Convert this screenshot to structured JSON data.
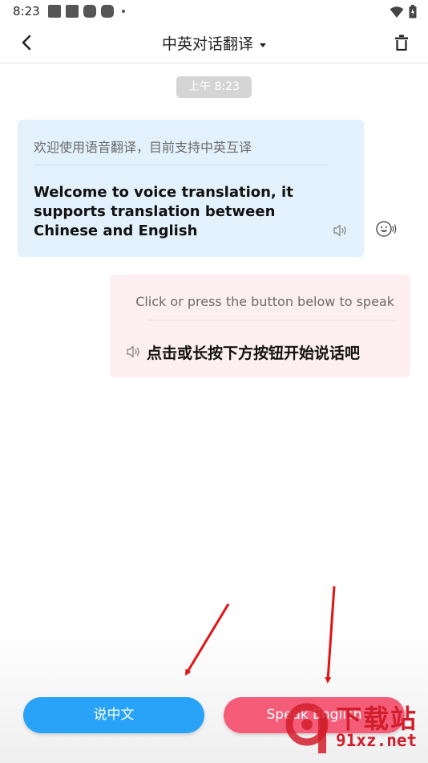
{
  "status_bar": {
    "time": "8:23",
    "icons": [
      "notification-icon",
      "notification-icon",
      "notification-icon",
      "notification-icon",
      "wifi-icon",
      "battery-icon"
    ]
  },
  "app_bar": {
    "title": "中英对话翻译",
    "back_icon": "back-arrow-icon",
    "clear_icon": "trash-icon"
  },
  "chat": {
    "timestamp": "上午 8:23",
    "messages": [
      {
        "side": "left",
        "source_text": "欢迎使用语音翻译，目前支持中英互译",
        "translated_text": "Welcome to voice translation, it supports translation between Chinese and English",
        "bg_color": "#e3f1fc"
      },
      {
        "side": "right",
        "source_text": "Click or press the button below to speak",
        "translated_text": "点击或长按下方按钮开始说话吧",
        "bg_color": "#fdeff0"
      }
    ]
  },
  "buttons": {
    "speak_chinese": "说中文",
    "speak_english": "Speak English",
    "speak_chinese_color": "#29a3f7",
    "speak_english_color": "#f45c78"
  },
  "watermark": {
    "text": "下载站",
    "url": "91xz.net",
    "color": "#d21e2c"
  }
}
